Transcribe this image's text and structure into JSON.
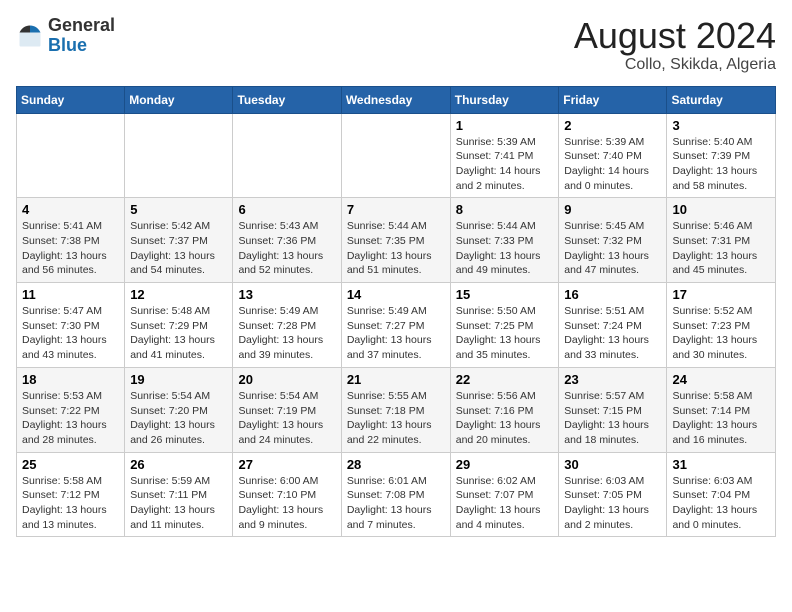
{
  "header": {
    "logo_general": "General",
    "logo_blue": "Blue",
    "month_year": "August 2024",
    "location": "Collo, Skikda, Algeria"
  },
  "weekdays": [
    "Sunday",
    "Monday",
    "Tuesday",
    "Wednesday",
    "Thursday",
    "Friday",
    "Saturday"
  ],
  "weeks": [
    [
      {
        "day": "",
        "info": ""
      },
      {
        "day": "",
        "info": ""
      },
      {
        "day": "",
        "info": ""
      },
      {
        "day": "",
        "info": ""
      },
      {
        "day": "1",
        "sunrise": "Sunrise: 5:39 AM",
        "sunset": "Sunset: 7:41 PM",
        "daylight": "Daylight: 14 hours and 2 minutes."
      },
      {
        "day": "2",
        "sunrise": "Sunrise: 5:39 AM",
        "sunset": "Sunset: 7:40 PM",
        "daylight": "Daylight: 14 hours and 0 minutes."
      },
      {
        "day": "3",
        "sunrise": "Sunrise: 5:40 AM",
        "sunset": "Sunset: 7:39 PM",
        "daylight": "Daylight: 13 hours and 58 minutes."
      }
    ],
    [
      {
        "day": "4",
        "sunrise": "Sunrise: 5:41 AM",
        "sunset": "Sunset: 7:38 PM",
        "daylight": "Daylight: 13 hours and 56 minutes."
      },
      {
        "day": "5",
        "sunrise": "Sunrise: 5:42 AM",
        "sunset": "Sunset: 7:37 PM",
        "daylight": "Daylight: 13 hours and 54 minutes."
      },
      {
        "day": "6",
        "sunrise": "Sunrise: 5:43 AM",
        "sunset": "Sunset: 7:36 PM",
        "daylight": "Daylight: 13 hours and 52 minutes."
      },
      {
        "day": "7",
        "sunrise": "Sunrise: 5:44 AM",
        "sunset": "Sunset: 7:35 PM",
        "daylight": "Daylight: 13 hours and 51 minutes."
      },
      {
        "day": "8",
        "sunrise": "Sunrise: 5:44 AM",
        "sunset": "Sunset: 7:33 PM",
        "daylight": "Daylight: 13 hours and 49 minutes."
      },
      {
        "day": "9",
        "sunrise": "Sunrise: 5:45 AM",
        "sunset": "Sunset: 7:32 PM",
        "daylight": "Daylight: 13 hours and 47 minutes."
      },
      {
        "day": "10",
        "sunrise": "Sunrise: 5:46 AM",
        "sunset": "Sunset: 7:31 PM",
        "daylight": "Daylight: 13 hours and 45 minutes."
      }
    ],
    [
      {
        "day": "11",
        "sunrise": "Sunrise: 5:47 AM",
        "sunset": "Sunset: 7:30 PM",
        "daylight": "Daylight: 13 hours and 43 minutes."
      },
      {
        "day": "12",
        "sunrise": "Sunrise: 5:48 AM",
        "sunset": "Sunset: 7:29 PM",
        "daylight": "Daylight: 13 hours and 41 minutes."
      },
      {
        "day": "13",
        "sunrise": "Sunrise: 5:49 AM",
        "sunset": "Sunset: 7:28 PM",
        "daylight": "Daylight: 13 hours and 39 minutes."
      },
      {
        "day": "14",
        "sunrise": "Sunrise: 5:49 AM",
        "sunset": "Sunset: 7:27 PM",
        "daylight": "Daylight: 13 hours and 37 minutes."
      },
      {
        "day": "15",
        "sunrise": "Sunrise: 5:50 AM",
        "sunset": "Sunset: 7:25 PM",
        "daylight": "Daylight: 13 hours and 35 minutes."
      },
      {
        "day": "16",
        "sunrise": "Sunrise: 5:51 AM",
        "sunset": "Sunset: 7:24 PM",
        "daylight": "Daylight: 13 hours and 33 minutes."
      },
      {
        "day": "17",
        "sunrise": "Sunrise: 5:52 AM",
        "sunset": "Sunset: 7:23 PM",
        "daylight": "Daylight: 13 hours and 30 minutes."
      }
    ],
    [
      {
        "day": "18",
        "sunrise": "Sunrise: 5:53 AM",
        "sunset": "Sunset: 7:22 PM",
        "daylight": "Daylight: 13 hours and 28 minutes."
      },
      {
        "day": "19",
        "sunrise": "Sunrise: 5:54 AM",
        "sunset": "Sunset: 7:20 PM",
        "daylight": "Daylight: 13 hours and 26 minutes."
      },
      {
        "day": "20",
        "sunrise": "Sunrise: 5:54 AM",
        "sunset": "Sunset: 7:19 PM",
        "daylight": "Daylight: 13 hours and 24 minutes."
      },
      {
        "day": "21",
        "sunrise": "Sunrise: 5:55 AM",
        "sunset": "Sunset: 7:18 PM",
        "daylight": "Daylight: 13 hours and 22 minutes."
      },
      {
        "day": "22",
        "sunrise": "Sunrise: 5:56 AM",
        "sunset": "Sunset: 7:16 PM",
        "daylight": "Daylight: 13 hours and 20 minutes."
      },
      {
        "day": "23",
        "sunrise": "Sunrise: 5:57 AM",
        "sunset": "Sunset: 7:15 PM",
        "daylight": "Daylight: 13 hours and 18 minutes."
      },
      {
        "day": "24",
        "sunrise": "Sunrise: 5:58 AM",
        "sunset": "Sunset: 7:14 PM",
        "daylight": "Daylight: 13 hours and 16 minutes."
      }
    ],
    [
      {
        "day": "25",
        "sunrise": "Sunrise: 5:58 AM",
        "sunset": "Sunset: 7:12 PM",
        "daylight": "Daylight: 13 hours and 13 minutes."
      },
      {
        "day": "26",
        "sunrise": "Sunrise: 5:59 AM",
        "sunset": "Sunset: 7:11 PM",
        "daylight": "Daylight: 13 hours and 11 minutes."
      },
      {
        "day": "27",
        "sunrise": "Sunrise: 6:00 AM",
        "sunset": "Sunset: 7:10 PM",
        "daylight": "Daylight: 13 hours and 9 minutes."
      },
      {
        "day": "28",
        "sunrise": "Sunrise: 6:01 AM",
        "sunset": "Sunset: 7:08 PM",
        "daylight": "Daylight: 13 hours and 7 minutes."
      },
      {
        "day": "29",
        "sunrise": "Sunrise: 6:02 AM",
        "sunset": "Sunset: 7:07 PM",
        "daylight": "Daylight: 13 hours and 4 minutes."
      },
      {
        "day": "30",
        "sunrise": "Sunrise: 6:03 AM",
        "sunset": "Sunset: 7:05 PM",
        "daylight": "Daylight: 13 hours and 2 minutes."
      },
      {
        "day": "31",
        "sunrise": "Sunrise: 6:03 AM",
        "sunset": "Sunset: 7:04 PM",
        "daylight": "Daylight: 13 hours and 0 minutes."
      }
    ]
  ]
}
